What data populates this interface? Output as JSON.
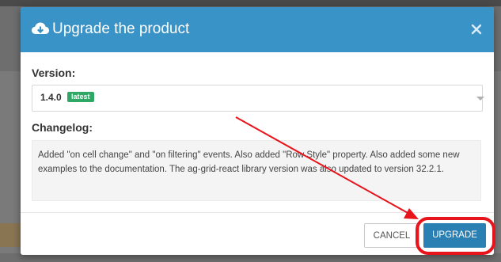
{
  "modal": {
    "title": "Upgrade the product",
    "header_icon": "cloud-download-icon",
    "close_icon": "close-icon",
    "header_color": "#3a93c6"
  },
  "version": {
    "label": "Version:",
    "selected_value": "1.4.0",
    "badge": "latest",
    "badge_color": "#2fa866"
  },
  "changelog": {
    "label": "Changelog:",
    "text": "Added \"on cell change\" and \"on filtering\" events. Also added \"Row Style\" property. Also added some new examples to the documentation. The ag-grid-react library version was also updated to version 32.2.1."
  },
  "footer": {
    "cancel_label": "CANCEL",
    "upgrade_label": "UPGRADE",
    "upgrade_color": "#2a7fb3"
  },
  "annotation": {
    "color": "#e8141c",
    "type": "arrow-and-circle"
  }
}
